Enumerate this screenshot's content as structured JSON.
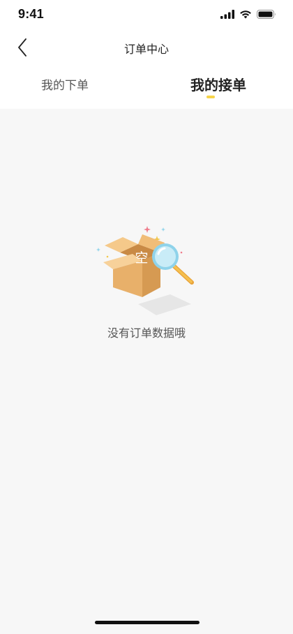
{
  "status_bar": {
    "time": "9:41"
  },
  "nav": {
    "title": "订单中心"
  },
  "tabs": [
    {
      "label": "我的下单",
      "active": false
    },
    {
      "label": "我的接单",
      "active": true
    }
  ],
  "empty_state": {
    "illustration_text": "空",
    "message": "没有订单数据哦"
  },
  "colors": {
    "accent": "#f7d44a",
    "background": "#f7f7f7",
    "box": "#e2a85e",
    "magnifier": "#8fd3ea"
  }
}
